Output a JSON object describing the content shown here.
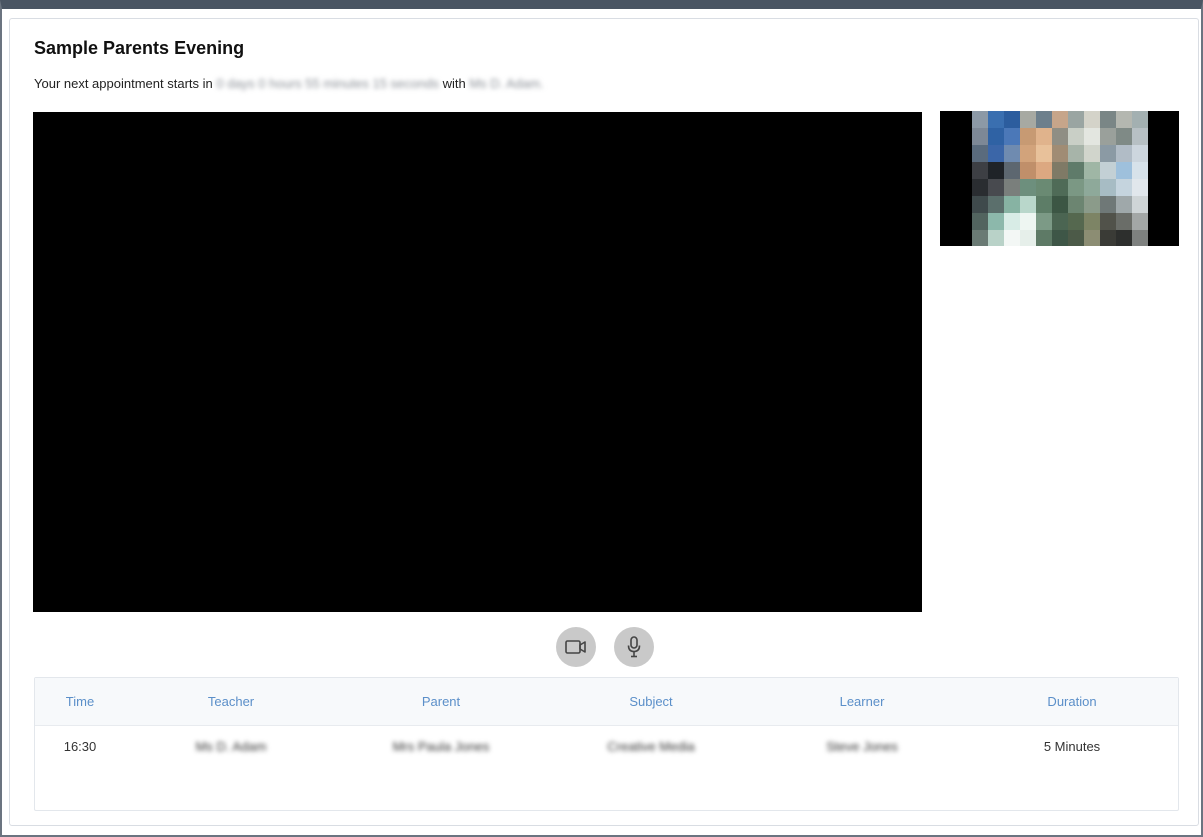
{
  "page": {
    "title": "Sample Parents Evening",
    "subtitle_prefix": "Your next appointment starts in",
    "subtitle_countdown": "0 days 0 hours 55 minutes 15 seconds",
    "subtitle_with": "with",
    "subtitle_teacher": "Ms D. Adam."
  },
  "controls": {
    "camera_icon": "camera-icon",
    "microphone_icon": "microphone-icon"
  },
  "table": {
    "headers": [
      "Time",
      "Teacher",
      "Parent",
      "Subject",
      "Learner",
      "Duration"
    ],
    "rows": [
      [
        "16:30",
        "Ms D. Adam",
        "Mrs Paula Jones",
        "Creative Media",
        "Steve Jones",
        "5 Minutes"
      ]
    ]
  },
  "colors": {
    "header_text": "#5b8fc9",
    "video_background": "#000000",
    "control_button": "#c9c9c9"
  }
}
